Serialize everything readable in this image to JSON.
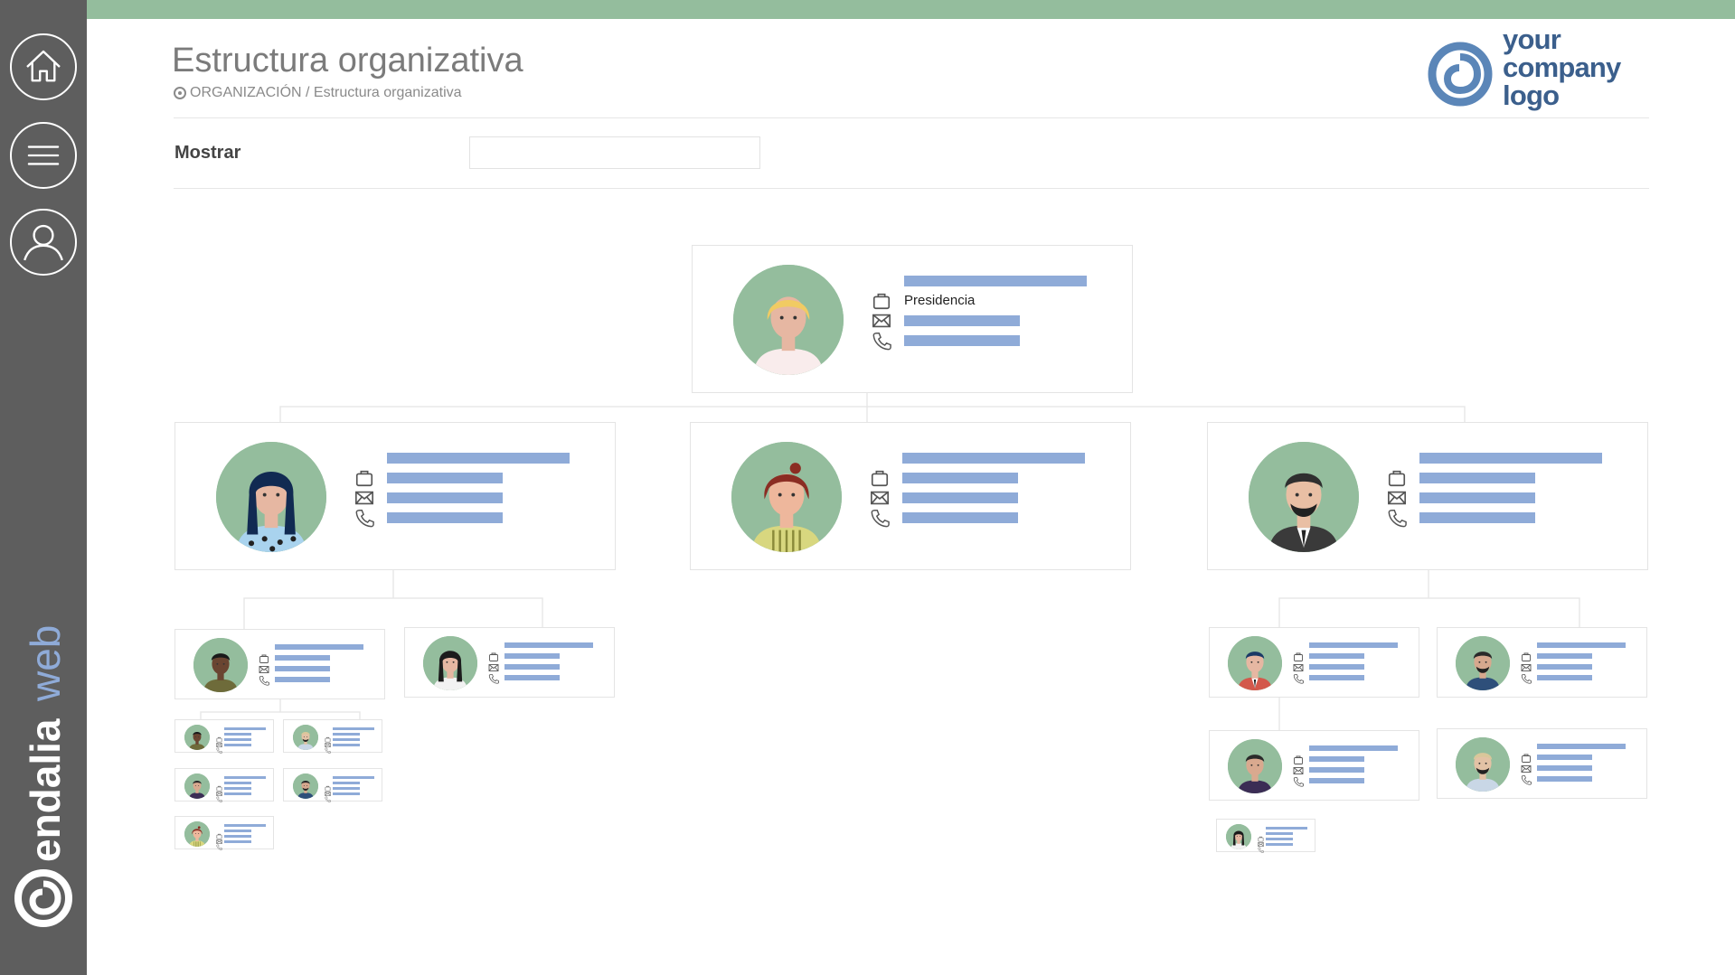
{
  "header": {
    "title": "Estructura organizativa",
    "breadcrumb": "ORGANIZACIÓN / Estructura organizativa",
    "logo_lines": [
      "your",
      "company",
      "logo"
    ]
  },
  "sidebar": {
    "items": [
      {
        "name": "home",
        "icon": "home-icon"
      },
      {
        "name": "menu",
        "icon": "hamburger-menu-icon"
      },
      {
        "name": "user",
        "icon": "user-icon"
      }
    ],
    "brand": {
      "name": "endalia",
      "suffix": "web"
    }
  },
  "filter": {
    "label": "Mostrar",
    "value": ""
  },
  "org": {
    "root": {
      "role": "Presidencia"
    }
  },
  "colors": {
    "topbar": "#94bd9d",
    "sidebar": "#5e5e5e",
    "avatar_bg": "#94bd9d",
    "placeholder_bar": "#8fabd8",
    "logo": "#3b5f8c",
    "brand_web": "#8fabd8"
  }
}
